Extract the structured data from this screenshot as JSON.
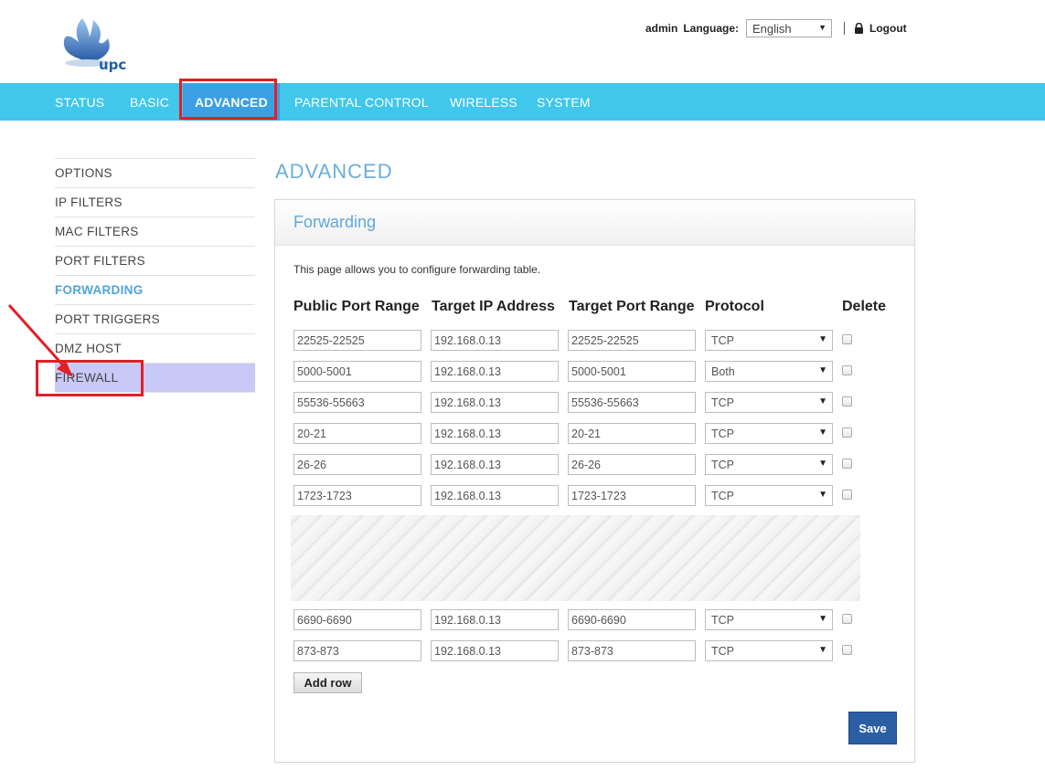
{
  "header": {
    "logo_text": "upc",
    "user": "admin",
    "language_label": "Language:",
    "language_value": "English",
    "logout_label": "Logout"
  },
  "nav": [
    {
      "label": "STATUS",
      "active": false
    },
    {
      "label": "BASIC",
      "active": false
    },
    {
      "label": "ADVANCED",
      "active": true
    },
    {
      "label": "PARENTAL CONTROL",
      "active": false
    },
    {
      "label": "WIRELESS",
      "active": false
    },
    {
      "label": "SYSTEM",
      "active": false
    }
  ],
  "sidebar": [
    {
      "label": "OPTIONS"
    },
    {
      "label": "IP FILTERS"
    },
    {
      "label": "MAC FILTERS"
    },
    {
      "label": "PORT FILTERS"
    },
    {
      "label": "FORWARDING",
      "active": true
    },
    {
      "label": "PORT TRIGGERS"
    },
    {
      "label": "DMZ HOST"
    },
    {
      "label": "FIREWALL",
      "hover": true
    }
  ],
  "main": {
    "page_title": "ADVANCED",
    "panel_title": "Forwarding",
    "description": "This page allows you to configure forwarding table.",
    "columns": [
      "Public Port Range",
      "Target IP Address",
      "Target Port Range",
      "Protocol",
      "Delete"
    ],
    "rows": [
      {
        "public": "22525-22525",
        "ip": "192.168.0.13",
        "target": "22525-22525",
        "protocol": "TCP"
      },
      {
        "public": "5000-5001",
        "ip": "192.168.0.13",
        "target": "5000-5001",
        "protocol": "Both"
      },
      {
        "public": "55536-55663",
        "ip": "192.168.0.13",
        "target": "55536-55663",
        "protocol": "TCP"
      },
      {
        "public": "20-21",
        "ip": "192.168.0.13",
        "target": "20-21",
        "protocol": "TCP"
      },
      {
        "public": "26-26",
        "ip": "192.168.0.13",
        "target": "26-26",
        "protocol": "TCP"
      },
      {
        "public": "1723-1723",
        "ip": "192.168.0.13",
        "target": "1723-1723",
        "protocol": "TCP"
      },
      {
        "public": "6690-6690",
        "ip": "192.168.0.13",
        "target": "6690-6690",
        "protocol": "TCP"
      },
      {
        "public": "873-873",
        "ip": "192.168.0.13",
        "target": "873-873",
        "protocol": "TCP"
      }
    ],
    "add_row_label": "Add row",
    "save_label": "Save"
  },
  "colors": {
    "nav_bar": "#41c7eb",
    "nav_active": "#3b9fe4",
    "accent_text": "#5ea8d8",
    "highlight_box": "#e01f26",
    "save_button": "#2a5fa3"
  },
  "icons": [
    "upc-logo",
    "lock-icon",
    "chevron-down-icon",
    "annotation-arrow"
  ]
}
